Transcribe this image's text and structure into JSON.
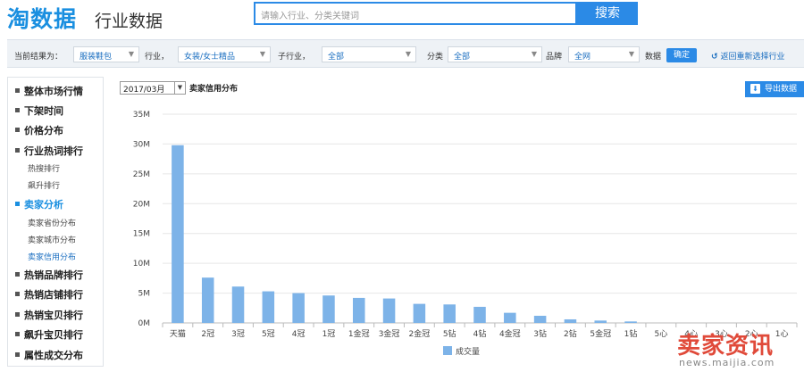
{
  "header": {
    "logo_text": "淘数据",
    "subtitle": "行业数据",
    "search_placeholder": "请输入行业、分类关键词",
    "search_button": "搜索"
  },
  "filters": {
    "current_label": "当前结果为：",
    "industry_value": "服装鞋包",
    "industry_label": "行业，",
    "industry2_value": "女装/女士精品",
    "subindustry_label": "子行业，",
    "subindustry_value": "全部",
    "category_label": "分类",
    "category_value": "全部",
    "brand_label": "品牌",
    "brand_value": "全网",
    "data_label": "数据",
    "confirm_button": "确定",
    "reset_link": "返回重新选择行业"
  },
  "sidebar": {
    "items": [
      {
        "label": "整体市场行情"
      },
      {
        "label": "下架时间"
      },
      {
        "label": "价格分布"
      },
      {
        "label": "行业热词排行"
      },
      {
        "label": "热搜排行"
      },
      {
        "label": "飙升排行"
      },
      {
        "label": "卖家分析"
      },
      {
        "label": "卖家省份分布"
      },
      {
        "label": "卖家城市分布"
      },
      {
        "label": "卖家信用分布"
      },
      {
        "label": "热销品牌排行"
      },
      {
        "label": "热销店铺排行"
      },
      {
        "label": "热销宝贝排行"
      },
      {
        "label": "飙升宝贝排行"
      },
      {
        "label": "属性成交分布"
      }
    ]
  },
  "toolbar": {
    "date_value": "2017/03月",
    "chart_title": "卖家信用分布",
    "export_button": "导出数据"
  },
  "chart_data": {
    "type": "bar",
    "categories": [
      "天猫",
      "2冠",
      "3冠",
      "5冠",
      "4冠",
      "1冠",
      "1金冠",
      "3金冠",
      "2金冠",
      "5钻",
      "4钻",
      "4金冠",
      "3钻",
      "2钻",
      "5金冠",
      "1钻",
      "5心",
      "4心",
      "3心",
      "2心",
      "1心"
    ],
    "series": [
      {
        "name": "成交量",
        "values": [
          29.8,
          7.6,
          6.1,
          5.3,
          5.0,
          4.6,
          4.2,
          4.1,
          3.2,
          3.1,
          2.7,
          1.7,
          1.2,
          0.6,
          0.4,
          0.25,
          0,
          0,
          0,
          0,
          0
        ]
      }
    ],
    "y_ticks": [
      "0M",
      "5M",
      "10M",
      "15M",
      "20M",
      "25M",
      "30M",
      "35M"
    ],
    "ylim": [
      0,
      35
    ],
    "legend_position": "bottom-center",
    "grid": true,
    "colors": {
      "bar": "#7db3e8",
      "grid": "#e6e6e6"
    }
  },
  "watermark": {
    "main": "卖家资讯",
    "url": "news.maijia.com"
  }
}
